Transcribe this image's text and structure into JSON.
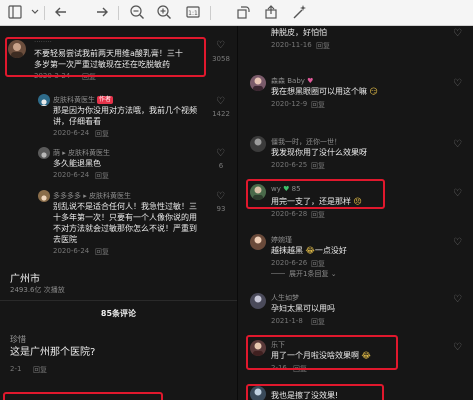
{
  "toolbar": {
    "icons": [
      "menu-icon",
      "back-icon",
      "forward-icon",
      "zoom-out-icon",
      "zoom-in-icon",
      "fit-icon",
      "rotate-icon",
      "share-icon",
      "magic-icon"
    ]
  },
  "left": {
    "c1": {
      "text1": "不要轻易尝试我前两天用维a酸乳膏！三十",
      "text2": "多岁第一次严重过敏现在还在吃脱敏药",
      "date": "2020-3-24",
      "reply": "回复",
      "likes": "3058"
    },
    "c2": {
      "name": "皮肤科黄医生",
      "badge": "作者",
      "text1": "那是因为你没用对方法哦，我前几个视频",
      "text2": "讲，仔细看看",
      "date": "2020-6-24",
      "reply": "回复",
      "likes": "1422"
    },
    "c3": {
      "name": "荫 ▸ 皮肤科黄医生",
      "text1": "多久能退黑色",
      "date": "2020-6-24",
      "reply": "回复",
      "likes": "6"
    },
    "c4": {
      "name": "多多多多 ▸ 皮肤科黄医生",
      "text1": "别乱说不是适合任何人！我急性过敏！三",
      "text2": "十多年第一次！只要有一个人像你说的用",
      "text3": "不对方法就会过敏那你怎么不说！严重到",
      "text4": "去医院",
      "date": "2020-6-24",
      "reply": "回复",
      "likes": "93"
    },
    "loc": {
      "title": "广州市",
      "sub": "2493.6亿 次播放"
    },
    "comments_count": "85条评论",
    "c5": {
      "name": "珍惜",
      "text1": "这是广州那个医院?",
      "date": "2-1",
      "reply": "回复"
    }
  },
  "right": {
    "top": {
      "text": "肿脱皮，好怕怕",
      "date": "2020-11-16",
      "reply": "回复"
    },
    "r1": {
      "name": "森森 Baby",
      "text": "我在想黑眼圈可以用这个嘛",
      "date": "2020-12-9",
      "reply": "回复"
    },
    "r2": {
      "name": "僵我一时，还你一世！",
      "text": "我发现你用了没什么效果呀",
      "date": "2020-6-25",
      "reply": "回复"
    },
    "r3": {
      "name": "wy",
      "name_suffix": "85",
      "text": "用完一支了，还是那样",
      "date": "2020-6-28",
      "reply": "回复"
    },
    "r4": {
      "name": "婷婉瑾",
      "text": "越抹越黑",
      "text_suffix": "一点没好",
      "date": "2020-6-26",
      "reply": "回复"
    },
    "expand": "展开1条回复",
    "r5": {
      "name": "人生如梦",
      "text": "孕妇太黑可以用吗",
      "date": "2021-1-8",
      "reply": "回复"
    },
    "r6": {
      "name": "乐下",
      "text": "用了一个月啦没啥效果啊",
      "date": "2-16",
      "reply": "回复"
    },
    "r7": {
      "text": "我也是擦了没效果!"
    }
  }
}
